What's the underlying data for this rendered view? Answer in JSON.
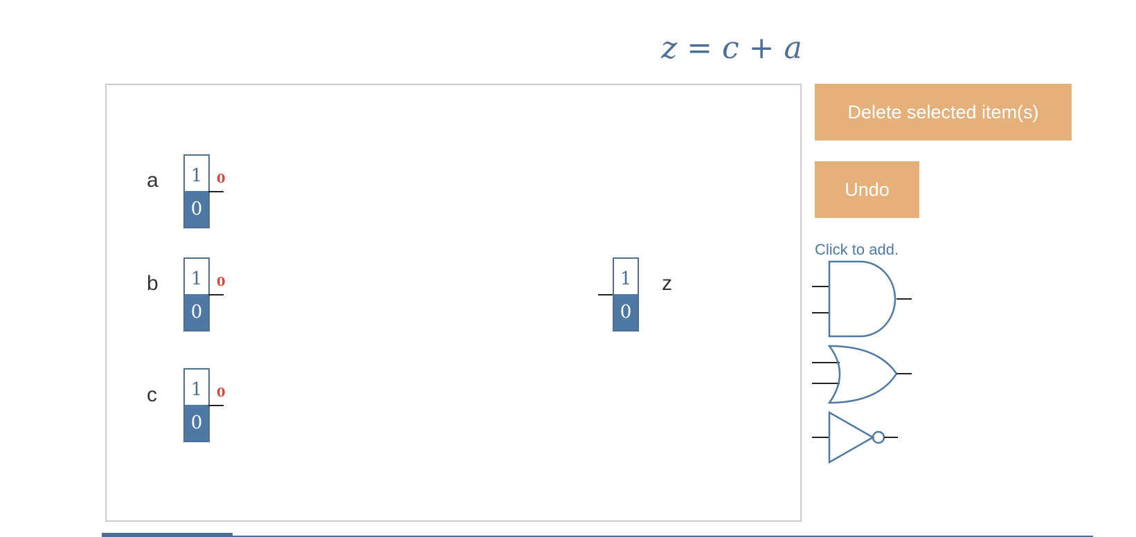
{
  "equation": "z = c + a",
  "canvas": {
    "inputs": [
      {
        "label": "a",
        "top_value": "1",
        "bottom_value": "0",
        "current_value": "0"
      },
      {
        "label": "b",
        "top_value": "1",
        "bottom_value": "0",
        "current_value": "0"
      },
      {
        "label": "c",
        "top_value": "1",
        "bottom_value": "0",
        "current_value": "0"
      }
    ],
    "output": {
      "label": "z",
      "top_value": "1",
      "bottom_value": "0"
    }
  },
  "buttons": {
    "delete_label": "Delete selected item(s)",
    "undo_label": "Undo"
  },
  "palette": {
    "hint": "Click to add.",
    "gates": [
      "and-gate-icon",
      "or-gate-icon",
      "not-gate-icon"
    ]
  },
  "colors": {
    "accent_button": "#e5b07a",
    "primary_blue": "#4d79a4",
    "value_red": "#d9453f"
  }
}
